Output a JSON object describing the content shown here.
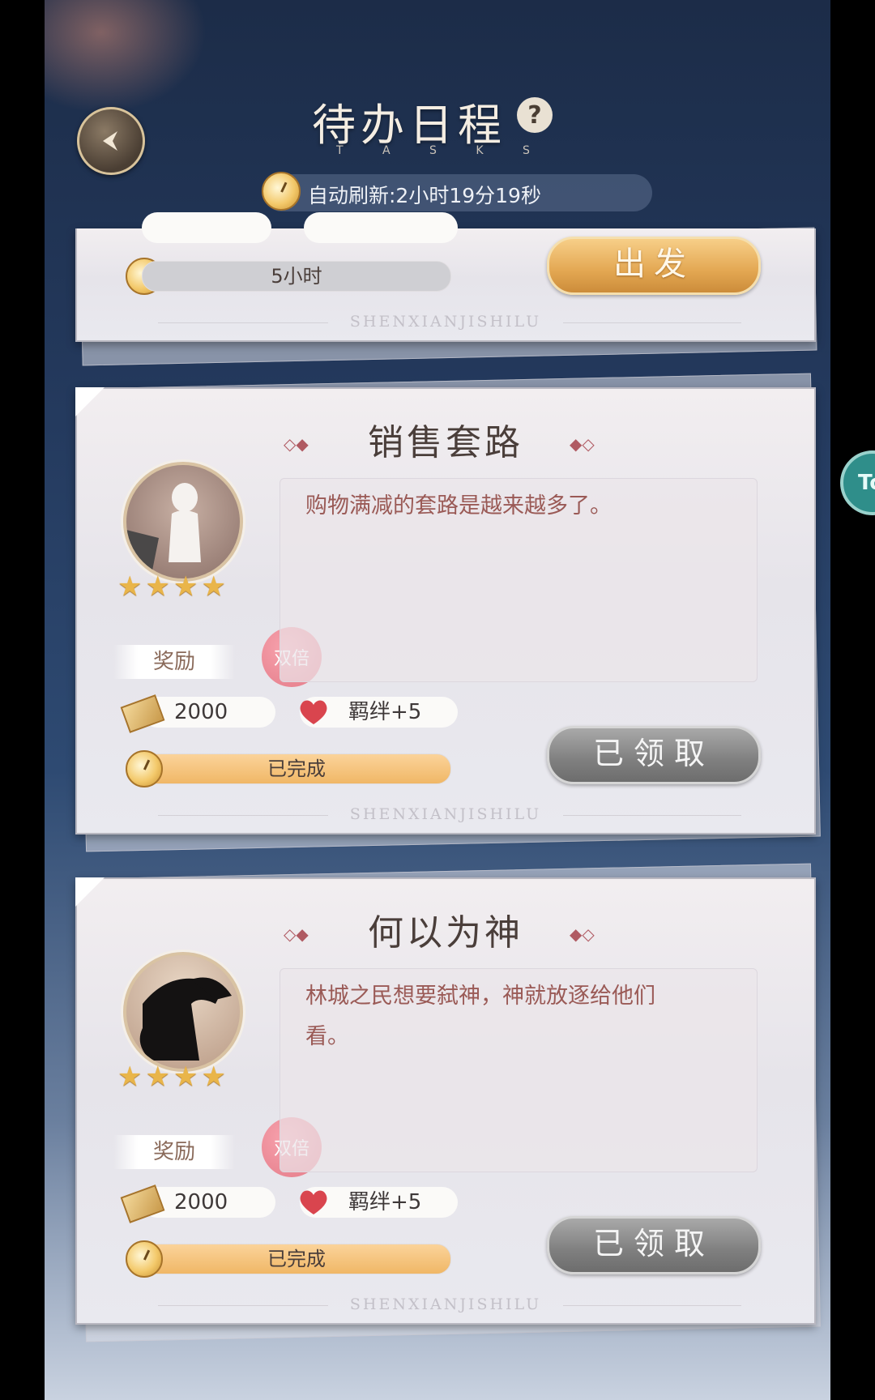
{
  "header": {
    "title": "待办日程",
    "subtitle": "T A S K S",
    "refresh_text": "自动刷新:2小时19分19秒",
    "help_glyph": "?"
  },
  "partial_task": {
    "progress_text": "5小时",
    "action_label": "出发",
    "footer": "SHENXIANJISHILU"
  },
  "tasks": [
    {
      "title": "销售套路",
      "description": "购物满减的套路是越来越多了。",
      "stars": "★★★★",
      "reward_label": "奖励",
      "double_badge": "双倍",
      "coin_reward": "2000",
      "bond_reward": "羁绊+5",
      "status_text": "已完成",
      "progress": 1.0,
      "action_label": "已领取",
      "footer": "SHENXIANJISHILU"
    },
    {
      "title": "何以为神",
      "description_line1": "林城之民想要弑神，神就放逐给他们",
      "description_line2": "看。",
      "stars": "★★★★",
      "reward_label": "奖励",
      "double_badge": "双倍",
      "coin_reward": "2000",
      "bond_reward": "羁绊+5",
      "status_text": "已完成",
      "progress": 1.0,
      "action_label": "已领取",
      "footer": "SHENXIANJISHILU"
    }
  ],
  "side_tab": {
    "label": "To"
  },
  "icons": {
    "back": "back-arrow-icon",
    "help": "question-icon",
    "clock": "stopwatch-icon",
    "coin": "ticket-icon",
    "bond": "heart-icon"
  },
  "colors": {
    "gold_button": "#e3a752",
    "claimed_button": "#7f7f7f",
    "progress_fill": "#f0b766",
    "double_badge": "#e47c89"
  }
}
